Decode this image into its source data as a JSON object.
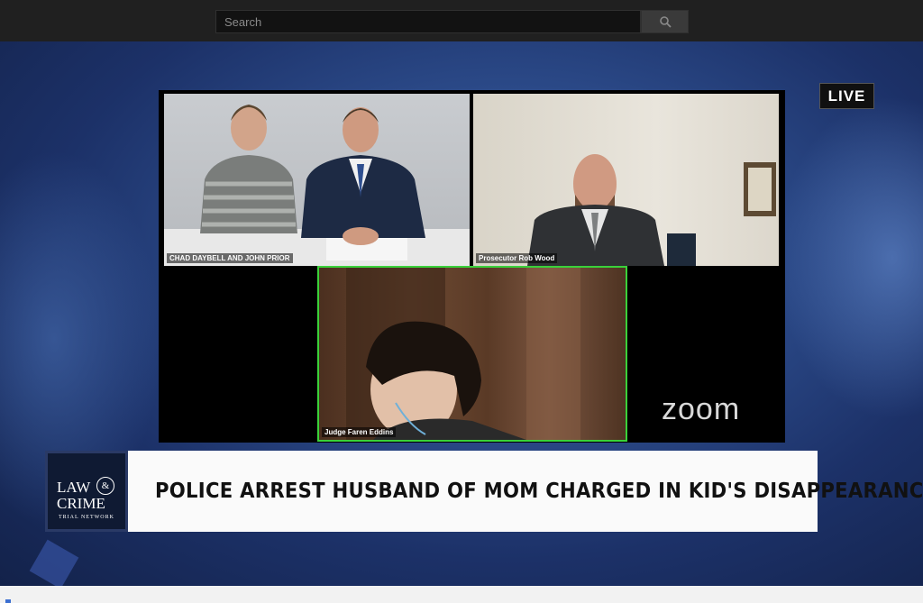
{
  "search": {
    "placeholder": "Search",
    "icon": "search-icon"
  },
  "video": {
    "live_badge": "LIVE",
    "participants": [
      {
        "label": "CHAD DAYBELL AND JOHN PRIOR"
      },
      {
        "label": "Prosecutor Rob Wood"
      },
      {
        "label": "Judge  Faren Eddins"
      }
    ],
    "zoom_logo": "zoom"
  },
  "lower_third": {
    "logo_line1": "LAW",
    "logo_amp": "&",
    "logo_line2": "CRIME",
    "logo_line3": "TRIAL NETWORK",
    "headline": "POLICE ARREST HUSBAND OF MOM CHARGED IN KID'S DISAPPEARANCE"
  },
  "colors": {
    "active_speaker_border": "#3ad13a",
    "background": "#1b2d5a"
  }
}
